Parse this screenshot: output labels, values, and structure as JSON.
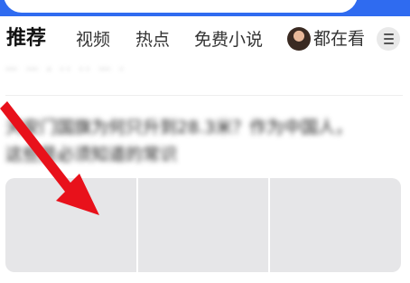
{
  "tabs": [
    {
      "label": "推荐",
      "active": true
    },
    {
      "label": "视频"
    },
    {
      "label": "热点"
    },
    {
      "label": "免费小说"
    },
    {
      "label": "都在看",
      "has_avatar": true
    }
  ],
  "menu": {
    "icon": "menu-icon"
  },
  "feed": {
    "prev_snippet": "…  … , .. ..  … .",
    "article": {
      "title": "天安门国旗为何只升到28.3米？作为中国人，这些是必须知道的常识"
    }
  },
  "colors": {
    "accent": "#2f6bf0",
    "annotation_arrow": "#e8111b"
  }
}
